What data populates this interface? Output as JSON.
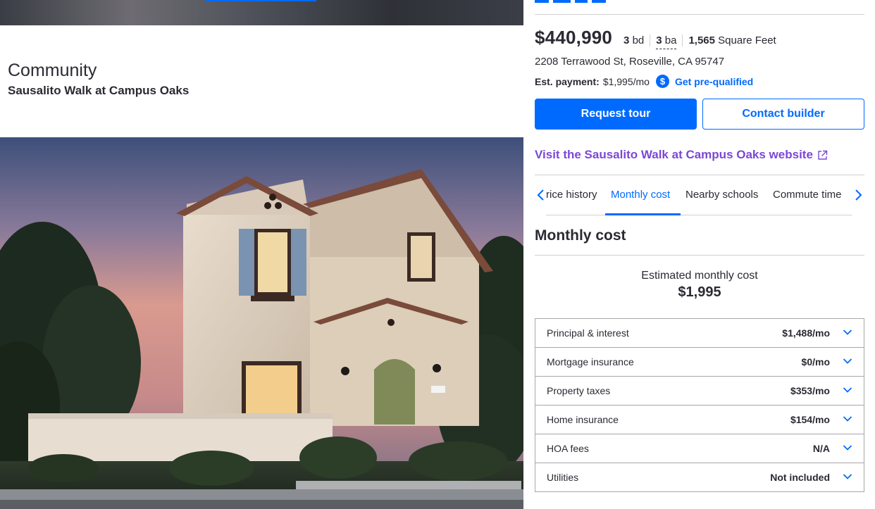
{
  "listing": {
    "price": "$440,990",
    "beds_value": "3",
    "beds_unit": "bd",
    "baths_value": "3",
    "baths_unit": "ba",
    "sqft_value": "1,565",
    "sqft_unit": "Square Feet",
    "address": "2208 Terrawood St, Roseville, CA 95747",
    "est_payment_label": "Est. payment:",
    "est_payment_value": "$1,995/mo",
    "dollar_icon": "$",
    "prequal_link": "Get pre-qualified",
    "request_tour": "Request tour",
    "contact_builder": "Contact builder",
    "visit_link": "Visit the Sausalito Walk at Campus Oaks website"
  },
  "community": {
    "heading": "Community",
    "name": "Sausalito Walk at Campus Oaks"
  },
  "tabs": [
    {
      "label": "rice history"
    },
    {
      "label": "Monthly cost"
    },
    {
      "label": "Nearby schools"
    },
    {
      "label": "Commute time"
    }
  ],
  "monthly_cost": {
    "title": "Monthly cost",
    "estimated_label": "Estimated monthly cost",
    "estimated_value": "$1,995",
    "rows": [
      {
        "label": "Principal & interest",
        "value": "$1,488/mo"
      },
      {
        "label": "Mortgage insurance",
        "value": "$0/mo"
      },
      {
        "label": "Property taxes",
        "value": "$353/mo"
      },
      {
        "label": "Home insurance",
        "value": "$154/mo"
      },
      {
        "label": "HOA fees",
        "value": "N/A"
      },
      {
        "label": "Utilities",
        "value": "Not included"
      }
    ]
  },
  "colors": {
    "accent": "#006aff",
    "visit_link": "#7a48d6",
    "text": "#2a2a33",
    "border": "#d1d1d5"
  },
  "icons": {
    "dollar": "dollar-icon",
    "external_link": "external-link-icon",
    "chevron_left": "chevron-left-icon",
    "chevron_right": "chevron-right-icon",
    "chevron_down": "chevron-down-icon"
  }
}
